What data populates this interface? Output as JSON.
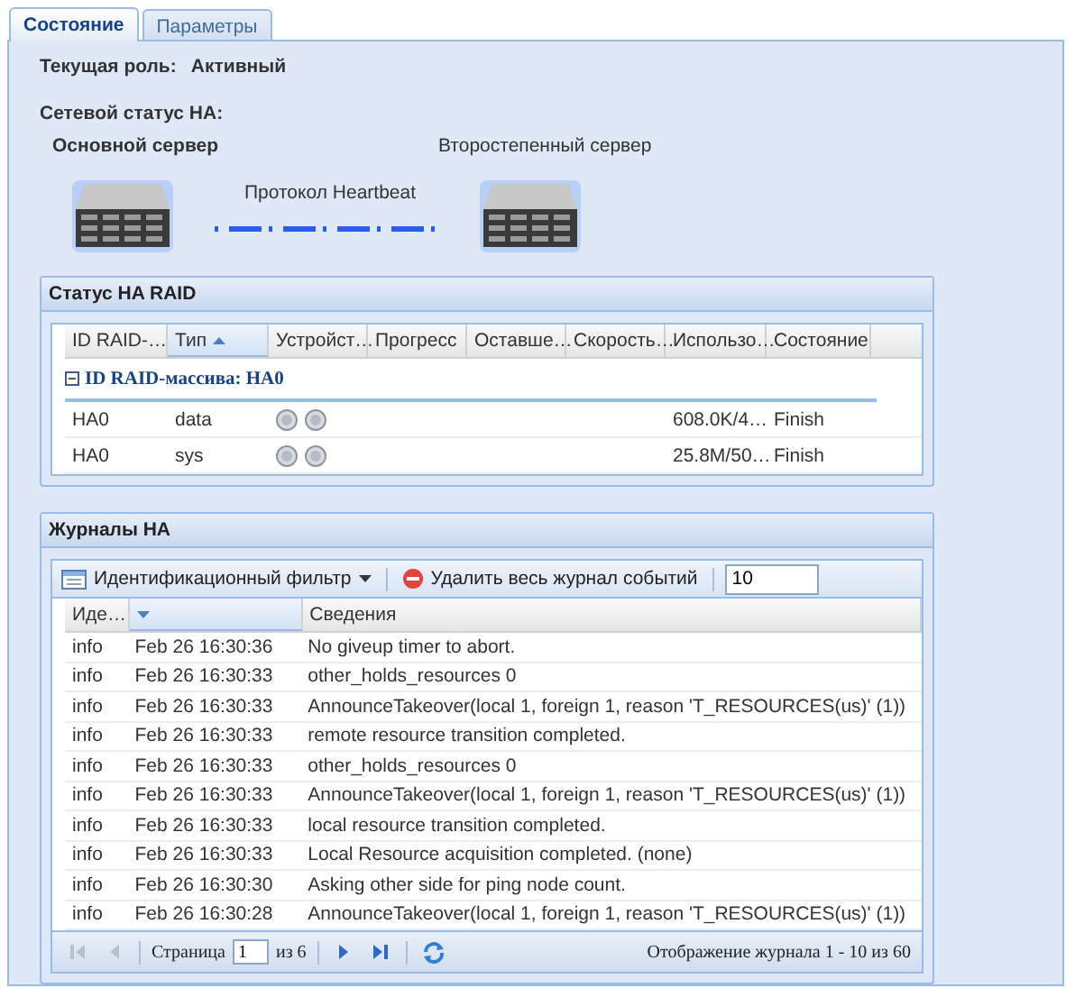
{
  "tabs": [
    {
      "label": "Состояние",
      "selected": true
    },
    {
      "label": "Параметры",
      "selected": false
    }
  ],
  "current_role": {
    "label": "Текущая роль:",
    "value": "Активный"
  },
  "network_status": {
    "title": "Сетевой статус HA:",
    "primary_server": "Основной сервер",
    "secondary_server": "Второстепенный сервер",
    "protocol_label": "Протокол Heartbeat"
  },
  "raid": {
    "title": "Статус HA RAID",
    "columns": [
      {
        "label": "ID RAID-…",
        "sorted": false
      },
      {
        "label": "Тип",
        "sorted": true,
        "descending": false
      },
      {
        "label": "Устройст…",
        "sorted": false
      },
      {
        "label": "Прогресс",
        "sorted": false
      },
      {
        "label": "Оставше…",
        "sorted": false
      },
      {
        "label": "Скорость…",
        "sorted": false
      },
      {
        "label": "Использо…",
        "sorted": false
      },
      {
        "label": "Состояние",
        "sorted": false
      }
    ],
    "group": {
      "label": "ID RAID-массива: HA0",
      "expanded": true
    },
    "rows": [
      {
        "id": "HA0",
        "type": "data",
        "usage": "608.0K/4…",
        "state": "Finish"
      },
      {
        "id": "HA0",
        "type": "sys",
        "usage": "25.8M/50…",
        "state": "Finish"
      }
    ]
  },
  "logs": {
    "title": "Журналы HA",
    "filter_button": "Идентификационный фильтр",
    "delete_button": "Удалить весь журнал событий",
    "page_size": "10",
    "columns": [
      {
        "label": "Иде…",
        "sorted": false
      },
      {
        "sorted": true,
        "descending": true
      },
      {
        "label": "Сведения",
        "sorted": false
      }
    ],
    "rows": [
      {
        "level": "info",
        "time": "Feb 26 16:30:36",
        "message": "No giveup timer to abort."
      },
      {
        "level": "info",
        "time": "Feb 26 16:30:33",
        "message": "other_holds_resources 0"
      },
      {
        "level": "info",
        "time": "Feb 26 16:30:33",
        "message": "AnnounceTakeover(local 1, foreign 1, reason 'T_RESOURCES(us)' (1))"
      },
      {
        "level": "info",
        "time": "Feb 26 16:30:33",
        "message": "remote resource transition completed."
      },
      {
        "level": "info",
        "time": "Feb 26 16:30:33",
        "message": "other_holds_resources 0"
      },
      {
        "level": "info",
        "time": "Feb 26 16:30:33",
        "message": "AnnounceTakeover(local 1, foreign 1, reason 'T_RESOURCES(us)' (1))"
      },
      {
        "level": "info",
        "time": "Feb 26 16:30:33",
        "message": "local resource transition completed."
      },
      {
        "level": "info",
        "time": "Feb 26 16:30:33",
        "message": "Local Resource acquisition completed. (none)"
      },
      {
        "level": "info",
        "time": "Feb 26 16:30:30",
        "message": "Asking other side for ping node count."
      },
      {
        "level": "info",
        "time": "Feb 26 16:30:28",
        "message": "AnnounceTakeover(local 1, foreign 1, reason 'T_RESOURCES(us)' (1))"
      }
    ],
    "pager": {
      "buttons": [
        {
          "kind": "first",
          "disabled": true
        },
        {
          "kind": "prev",
          "disabled": true
        }
      ],
      "page_label": "Страница",
      "page": "1",
      "of_label": "из 6",
      "nav_buttons": [
        {
          "kind": "next",
          "disabled": false
        },
        {
          "kind": "last",
          "disabled": false
        }
      ],
      "status": "Отображение журнала 1 - 10 из 60"
    }
  }
}
